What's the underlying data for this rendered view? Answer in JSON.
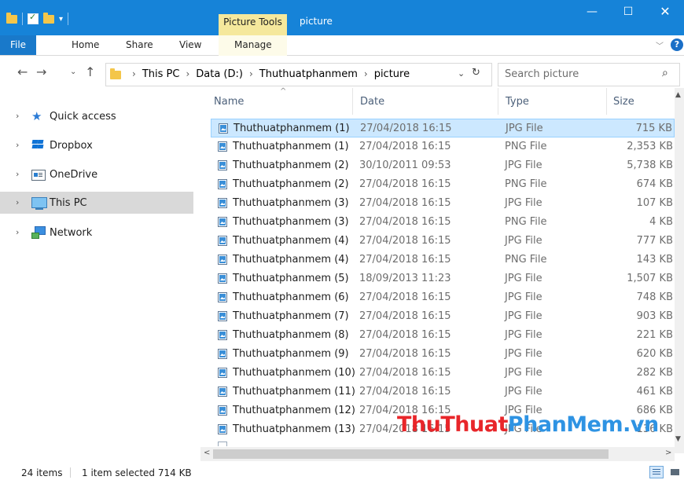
{
  "titlebar": {
    "context_group": "Picture Tools",
    "window_title": "picture",
    "minimize": "—",
    "maximize": "☐",
    "close": "✕"
  },
  "ribbon": {
    "tabs": [
      "File",
      "Home",
      "Share",
      "View",
      "Manage"
    ],
    "collapse": "﹀",
    "help": "?"
  },
  "address": {
    "back": "←",
    "forward": "→",
    "recent": "⌄",
    "up": "↑",
    "crumbs": [
      "This PC",
      "Data (D:)",
      "Thuthuatphanmem",
      "picture"
    ],
    "separator": "›",
    "dropdown": "⌄",
    "refresh": "↻"
  },
  "search": {
    "placeholder": "Search picture",
    "icon": "⌕"
  },
  "nav": {
    "chevron": "›",
    "items": [
      {
        "label": "Quick access",
        "icon": "star-icon"
      },
      {
        "label": "Dropbox",
        "icon": "dropbox-icon"
      },
      {
        "label": "OneDrive",
        "icon": "onedrive-icon"
      },
      {
        "label": "This PC",
        "icon": "computer-icon",
        "selected": true
      },
      {
        "label": "Network",
        "icon": "network-icon"
      }
    ]
  },
  "columns": {
    "name": "Name",
    "date": "Date",
    "type": "Type",
    "size": "Size",
    "sort_indicator": "^"
  },
  "files": [
    {
      "name": "Thuthuatphanmem (1)",
      "date": "27/04/2018 16:15",
      "type": "JPG File",
      "size": "715 KB",
      "selected": true
    },
    {
      "name": "Thuthuatphanmem (1)",
      "date": "27/04/2018 16:15",
      "type": "PNG File",
      "size": "2,353 KB"
    },
    {
      "name": "Thuthuatphanmem (2)",
      "date": "30/10/2011 09:53",
      "type": "JPG File",
      "size": "5,738 KB"
    },
    {
      "name": "Thuthuatphanmem (2)",
      "date": "27/04/2018 16:15",
      "type": "PNG File",
      "size": "674 KB"
    },
    {
      "name": "Thuthuatphanmem (3)",
      "date": "27/04/2018 16:15",
      "type": "JPG File",
      "size": "107 KB"
    },
    {
      "name": "Thuthuatphanmem (3)",
      "date": "27/04/2018 16:15",
      "type": "PNG File",
      "size": "4 KB"
    },
    {
      "name": "Thuthuatphanmem (4)",
      "date": "27/04/2018 16:15",
      "type": "JPG File",
      "size": "777 KB"
    },
    {
      "name": "Thuthuatphanmem (4)",
      "date": "27/04/2018 16:15",
      "type": "PNG File",
      "size": "143 KB"
    },
    {
      "name": "Thuthuatphanmem (5)",
      "date": "18/09/2013 11:23",
      "type": "JPG File",
      "size": "1,507 KB"
    },
    {
      "name": "Thuthuatphanmem (6)",
      "date": "27/04/2018 16:15",
      "type": "JPG File",
      "size": "748 KB"
    },
    {
      "name": "Thuthuatphanmem (7)",
      "date": "27/04/2018 16:15",
      "type": "JPG File",
      "size": "903 KB"
    },
    {
      "name": "Thuthuatphanmem (8)",
      "date": "27/04/2018 16:15",
      "type": "JPG File",
      "size": "221 KB"
    },
    {
      "name": "Thuthuatphanmem (9)",
      "date": "27/04/2018 16:15",
      "type": "JPG File",
      "size": "620 KB"
    },
    {
      "name": "Thuthuatphanmem (10)",
      "date": "27/04/2018 16:15",
      "type": "JPG File",
      "size": "282 KB"
    },
    {
      "name": "Thuthuatphanmem (11)",
      "date": "27/04/2018 16:15",
      "type": "JPG File",
      "size": "461 KB"
    },
    {
      "name": "Thuthuatphanmem (12)",
      "date": "27/04/2018 16:15",
      "type": "JPG File",
      "size": "686 KB"
    },
    {
      "name": "Thuthuatphanmem (13)",
      "date": "27/04/2018 16:15",
      "type": "JPG File",
      "size": "136 KB"
    }
  ],
  "scroll": {
    "up": "▲",
    "down": "▼",
    "left": "<",
    "right": ">"
  },
  "status": {
    "count": "24 items",
    "selected": "1 item selected  714 KB"
  },
  "watermark": {
    "part1": "ThuThuat",
    "part2": "PhanMem",
    "part3": ".vn"
  },
  "colors": {
    "titlebar": "#1683d8",
    "file_tab": "#1979ca",
    "context_group": "#f5e89c",
    "selection": "#cce8ff",
    "nav_selected": "#d9d9d9"
  }
}
